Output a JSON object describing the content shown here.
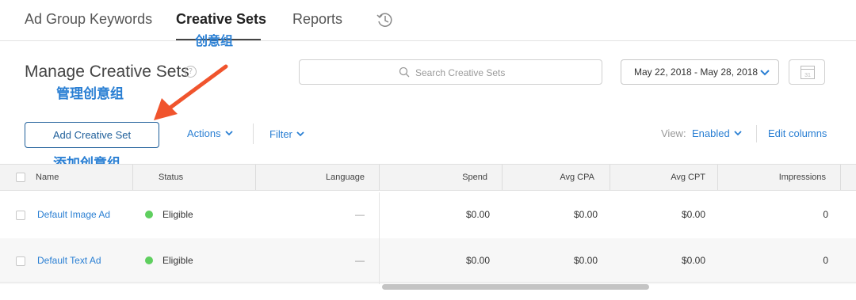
{
  "nav": {
    "tabs": [
      "Ad Group Keywords",
      "Creative Sets",
      "Reports"
    ],
    "active_tab": "Creative Sets",
    "history_icon": "history-clock-icon"
  },
  "annotations": {
    "creative_sets_cn": "创意组",
    "manage_cn": "管理创意组",
    "add_cn": "添加创意组",
    "color": "#2a7fd3",
    "arrow_color": "#f0542d"
  },
  "header": {
    "title": "Manage Creative Sets",
    "help_icon": "?"
  },
  "search": {
    "placeholder": "Search Creative Sets"
  },
  "date_range": {
    "value": "May 22, 2018 - May 28, 2018"
  },
  "calendar": {
    "day": "31"
  },
  "toolbar": {
    "add_label": "Add Creative Set",
    "actions_label": "Actions",
    "filter_label": "Filter",
    "view_label": "View:",
    "view_value": "Enabled",
    "edit_columns_label": "Edit columns"
  },
  "table": {
    "columns": [
      "Name",
      "Status",
      "Language",
      "Spend",
      "Avg CPA",
      "Avg CPT",
      "Impressions"
    ],
    "rows": [
      {
        "name": "Default Image Ad",
        "status": "Eligible",
        "language": "—",
        "spend": "$0.00",
        "avg_cpa": "$0.00",
        "avg_cpt": "$0.00",
        "impressions": "0"
      },
      {
        "name": "Default Text Ad",
        "status": "Eligible",
        "language": "—",
        "spend": "$0.00",
        "avg_cpa": "$0.00",
        "avg_cpt": "$0.00",
        "impressions": "0"
      }
    ],
    "status_color": "#5fcf5f"
  },
  "colors": {
    "accent": "#2a7fd3",
    "button_border": "#1f5f9a"
  }
}
